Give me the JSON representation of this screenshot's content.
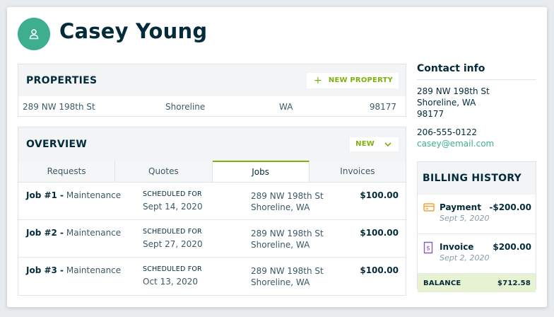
{
  "client": {
    "name": "Casey Young"
  },
  "properties": {
    "title": "PROPERTIES",
    "new_label": "NEW PROPERTY",
    "row": {
      "street": "289 NW 198th St",
      "city": "Shoreline",
      "state": "WA",
      "zip": "98177"
    }
  },
  "overview": {
    "title": "OVERVIEW",
    "new_label": "NEW",
    "tabs": [
      {
        "label": "Requests",
        "active": false
      },
      {
        "label": "Quotes",
        "active": false
      },
      {
        "label": "Jobs",
        "active": true
      },
      {
        "label": "Invoices",
        "active": false
      }
    ],
    "jobs": [
      {
        "number": "Job #1 -",
        "type": "Maintenance",
        "sched_label": "SCHEDULED FOR",
        "date": "Sept 14, 2020",
        "street": "289 NW 198th St",
        "city": "Shoreline, WA",
        "amount": "$100.00"
      },
      {
        "number": "Job #2 -",
        "type": "Maintenance",
        "sched_label": "SCHEDULED FOR",
        "date": "Sept 27, 2020",
        "street": "289 NW 198th St",
        "city": "Shoreline, WA",
        "amount": "$100.00"
      },
      {
        "number": "Job #3 -",
        "type": "Maintenance",
        "sched_label": "SCHEDULED FOR",
        "date": "Oct 13, 2020",
        "street": "289 NW 198th St",
        "city": "Shoreline, WA",
        "amount": "$100.00"
      }
    ]
  },
  "contact": {
    "title": "Contact info",
    "street": "289 NW 198th St",
    "city_state": "Shoreline, WA",
    "zip": "98177",
    "phone": "206-555-0122",
    "email": "casey@email.com"
  },
  "billing": {
    "title": "BILLING HISTORY",
    "items": [
      {
        "name": "Payment",
        "date": "Sept 5, 2020",
        "amount": "-$200.00",
        "icon": "credit-card-icon"
      },
      {
        "name": "Invoice",
        "date": "Sept 2, 2020",
        "amount": "$200.00",
        "icon": "invoice-icon"
      }
    ],
    "balance_label": "BALANCE",
    "balance_value": "$712.58"
  },
  "colors": {
    "brand_dark": "#032b3a",
    "accent_green": "#7db00e",
    "avatar_teal": "#3eaf8e",
    "payment_orange": "#f2a33a",
    "invoice_purple": "#8a5fb8",
    "balance_bg": "#e6f2d2"
  }
}
